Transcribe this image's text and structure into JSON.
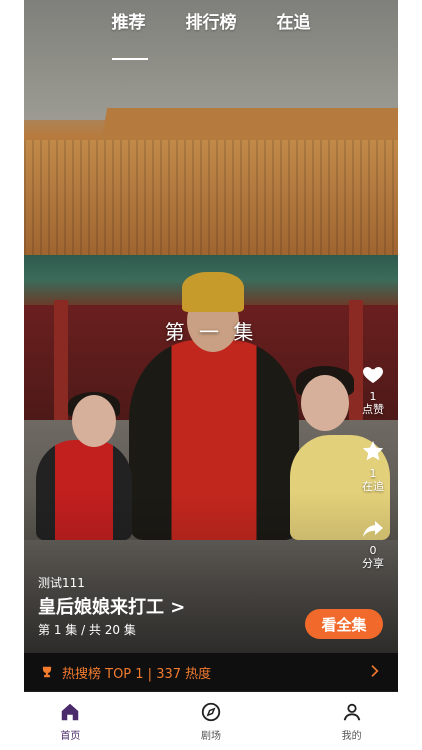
{
  "top_tabs": [
    {
      "label": "推荐",
      "active": true
    },
    {
      "label": "排行榜",
      "active": false
    },
    {
      "label": "在追",
      "active": false
    }
  ],
  "video": {
    "episode_overlay": "第 一 集"
  },
  "actions": {
    "like": {
      "count": "1",
      "label": "点赞",
      "icon": "heart-icon"
    },
    "follow": {
      "count": "1",
      "label": "在追",
      "icon": "star-icon"
    },
    "share": {
      "count": "0",
      "label": "分享",
      "icon": "share-icon"
    }
  },
  "info": {
    "uploader": "测试111",
    "title": "皇后娘娘来打工 >",
    "progress": "第 1 集 / 共 20 集",
    "watch_all_label": "看全集"
  },
  "hot_bar": {
    "text": "热搜榜 TOP 1 | 337 热度",
    "icon": "trophy-icon"
  },
  "bottom_nav": [
    {
      "label": "首页",
      "icon": "home-icon",
      "active": true
    },
    {
      "label": "剧场",
      "icon": "compass-icon",
      "active": false
    },
    {
      "label": "我的",
      "icon": "user-icon",
      "active": false
    }
  ],
  "colors": {
    "accent": "#f26a2b",
    "hot_text": "#f27b2e",
    "nav_active": "#4a2a6b"
  }
}
